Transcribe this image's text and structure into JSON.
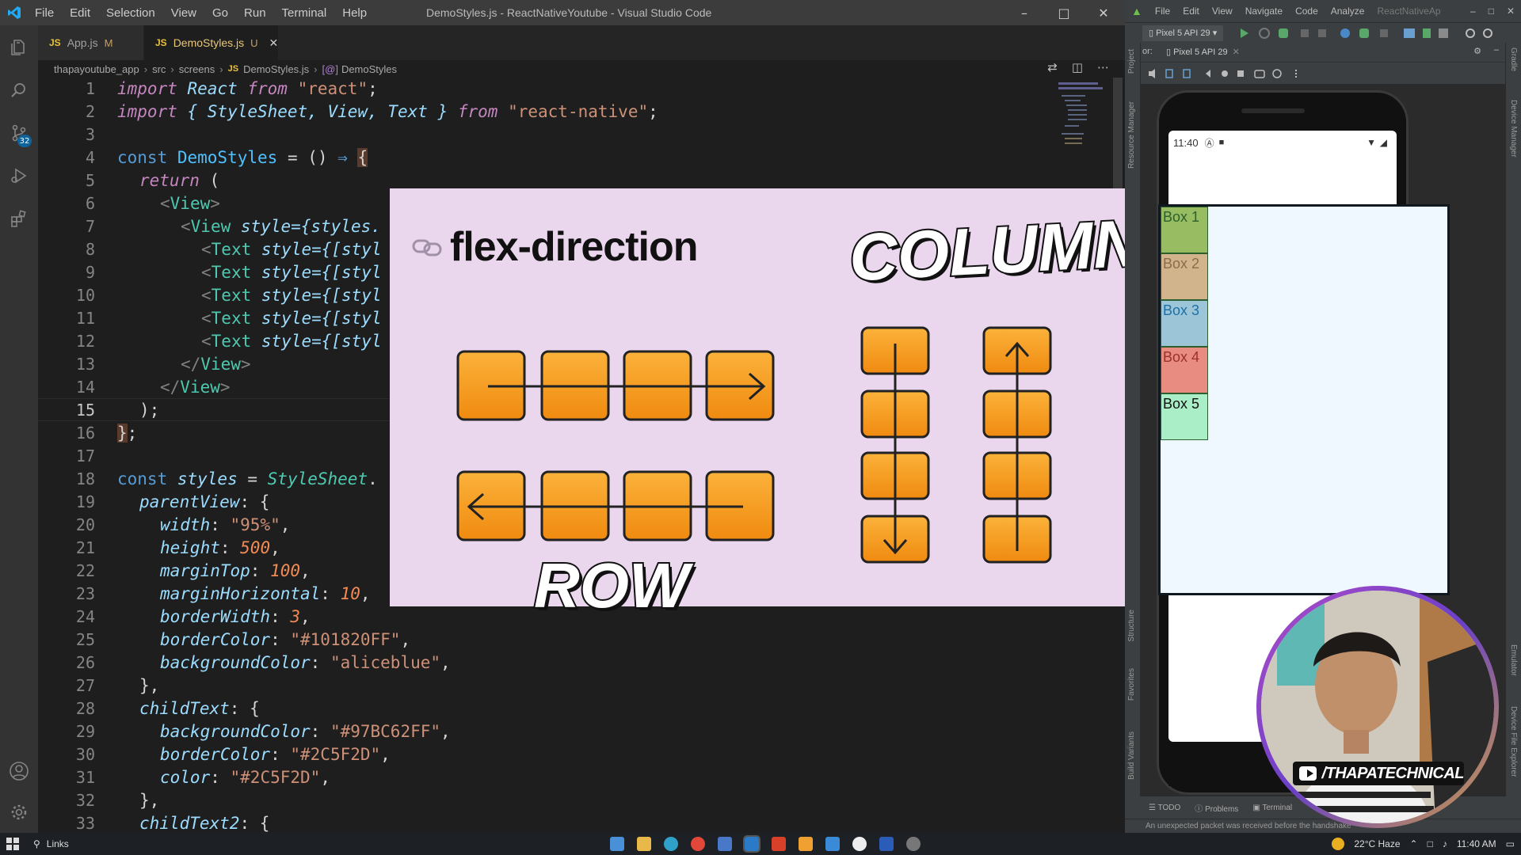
{
  "vscode": {
    "window_title": "DemoStyles.js - ReactNativeYoutube - Visual Studio Code",
    "menu": [
      "File",
      "Edit",
      "Selection",
      "View",
      "Go",
      "Run",
      "Terminal",
      "Help"
    ],
    "source_control_badge": "32",
    "tabs": [
      {
        "icon": "JS",
        "label": "App.js",
        "status": "M"
      },
      {
        "icon": "JS",
        "label": "DemoStyles.js",
        "status": "U"
      }
    ],
    "breadcrumb": [
      "thapayoutube_app",
      "src",
      "screens",
      "DemoStyles.js",
      "DemoStyles"
    ],
    "breadcrumb_file_icon": "JS",
    "breadcrumb_symbol_icon": "[@]",
    "line_numbers": [
      "1",
      "2",
      "3",
      "4",
      "5",
      "6",
      "7",
      "8",
      "9",
      "10",
      "11",
      "12",
      "13",
      "14",
      "15",
      "16",
      "17",
      "18",
      "19",
      "20",
      "21",
      "22",
      "23",
      "24",
      "25",
      "26",
      "27",
      "28",
      "29",
      "30",
      "31",
      "32",
      "33"
    ],
    "code": {
      "l1": {
        "kw1": "import",
        "id": " React ",
        "kw2": "from",
        "str": " \"react\"",
        "end": ";"
      },
      "l2": {
        "kw1": "import",
        "mid": " { StyleSheet, View, Text } ",
        "kw2": "from",
        "str": " \"react-native\"",
        "end": ";"
      },
      "l4": {
        "kw": "const ",
        "name": "DemoStyles",
        "rest": " = () ",
        "arrow": "⇒",
        "sp": " ",
        "brace": "{"
      },
      "l5": {
        "kw": "return",
        "rest": " ("
      },
      "l6": {
        "open": "<",
        "tag": "View",
        "close": ">"
      },
      "l7": {
        "open": "<",
        "tag": "View",
        "attr": " style",
        "rest": "={styles."
      },
      "l8": {
        "open": "<",
        "tag": "Text",
        "attr": " style",
        "rest": "={[styl"
      },
      "l9": {
        "open": "<",
        "tag": "Text",
        "attr": " style",
        "rest": "={[styl"
      },
      "l10": {
        "open": "<",
        "tag": "Text",
        "attr": " style",
        "rest": "={[styl"
      },
      "l11": {
        "open": "<",
        "tag": "Text",
        "attr": " style",
        "rest": "={[styl"
      },
      "l12": {
        "open": "<",
        "tag": "Text",
        "attr": " style",
        "rest": "={[styl"
      },
      "l13": {
        "open": "</",
        "tag": "View",
        "close": ">"
      },
      "l14": {
        "open": "</",
        "tag": "View",
        "close": ">"
      },
      "l15": {
        "text": ");"
      },
      "l16": {
        "brace": "}",
        "end": ";"
      },
      "l18": {
        "kw": "const ",
        "name": "styles",
        "rest": " = ",
        "cls": "StyleSheet",
        "tail": "."
      },
      "l19": {
        "prop": "parentView",
        "rest": ": {"
      },
      "l20": {
        "prop": "width",
        "colon": ": ",
        "val": "\"95%\"",
        "end": ","
      },
      "l21": {
        "prop": "height",
        "colon": ": ",
        "val": "500",
        "end": ","
      },
      "l22": {
        "prop": "marginTop",
        "colon": ": ",
        "val": "100",
        "end": ","
      },
      "l23": {
        "prop": "marginHorizontal",
        "colon": ": ",
        "val": "10",
        "end": ","
      },
      "l24": {
        "prop": "borderWidth",
        "colon": ": ",
        "val": "3",
        "end": ","
      },
      "l25": {
        "prop": "borderColor",
        "colon": ": ",
        "val": "\"#101820FF\"",
        "end": ","
      },
      "l26": {
        "prop": "backgroundColor",
        "colon": ": ",
        "val": "\"aliceblue\"",
        "end": ","
      },
      "l27": {
        "text": "},"
      },
      "l28": {
        "prop": "childText",
        "rest": ": {"
      },
      "l29": {
        "prop": "backgroundColor",
        "colon": ": ",
        "val": "\"#97BC62FF\"",
        "end": ","
      },
      "l30": {
        "prop": "borderColor",
        "colon": ": ",
        "val": "\"#2C5F2D\"",
        "end": ","
      },
      "l31": {
        "prop": "color",
        "colon": ": ",
        "val": "\"#2C5F2D\"",
        "end": ","
      },
      "l32": {
        "text": "},"
      },
      "l33": {
        "prop": "childText2",
        "rest": ": {"
      }
    }
  },
  "overlay": {
    "title": "flex-direction",
    "column_label": "COLUMN",
    "row_label": "ROW"
  },
  "studio": {
    "menu": [
      "File",
      "Edit",
      "View",
      "Navigate",
      "Code",
      "Analyze"
    ],
    "project_name": "ReactNativeAp",
    "device_selector": "Pixel 5 API 29",
    "emulator_tab_prefix": "or:",
    "emulator_tab": "Pixel 5 API 29",
    "left_strip": [
      "Project",
      "Resource Manager",
      "Structure",
      "Favorites",
      "Build Variants"
    ],
    "right_strip": [
      "Gradle",
      "Device Manager",
      "Emulator",
      "Device File Explorer"
    ],
    "bottom_tabs": [
      "TODO",
      "Problems",
      "Terminal"
    ],
    "status_message": "An unexpected packet was received before the handshake",
    "phone": {
      "time": "11:40",
      "boxes": [
        {
          "label": "Box 1",
          "bg": "#97BC62",
          "color": "#2C5F2D"
        },
        {
          "label": "Box 2",
          "bg": "#D2B48C",
          "color": "#8B6B4A"
        },
        {
          "label": "Box 3",
          "bg": "#9CC6D8",
          "color": "#1E6FA8"
        },
        {
          "label": "Box 4",
          "bg": "#E88C82",
          "color": "#9A3028"
        },
        {
          "label": "Box 5",
          "bg": "#A9EEC6",
          "color": "#111111"
        }
      ]
    }
  },
  "webcam": {
    "handle": "/THAPATECHNICAL"
  },
  "taskbar": {
    "search_label": "Links",
    "weather": "22°C Haze",
    "time": "11:40 AM"
  }
}
